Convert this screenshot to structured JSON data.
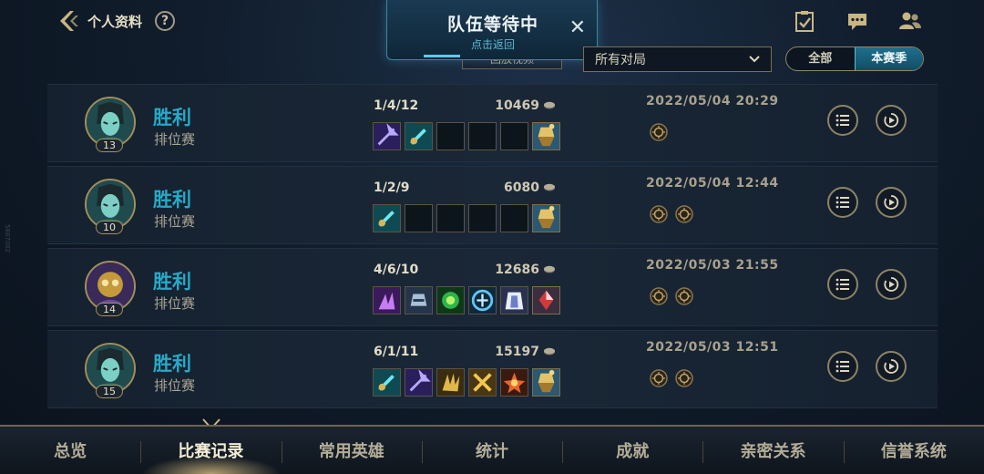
{
  "header": {
    "title": "个人资料",
    "help_label": "?",
    "icons": [
      "clipboard-check-icon",
      "chat-icon",
      "friends-icon"
    ]
  },
  "queue": {
    "title": "队伍等待中",
    "subtitle": "点击返回",
    "close_label": "✕",
    "hidden_tab_label": "回放视频"
  },
  "filter": {
    "selected": "所有对局",
    "season_options": [
      "全部",
      "本赛季"
    ],
    "season_active": "本赛季"
  },
  "matches": [
    {
      "result": "胜利",
      "mode": "排位赛",
      "level": "13",
      "kda": "1/4/12",
      "gold": "10469",
      "date": "2022/05/04 20:29",
      "champion": "teal",
      "items": [
        "purple-axe",
        "teal-blade",
        "",
        "",
        "",
        "gold-lantern"
      ],
      "badges": 1
    },
    {
      "result": "胜利",
      "mode": "排位赛",
      "level": "10",
      "kda": "1/2/9",
      "gold": "6080",
      "date": "2022/05/04 12:44",
      "champion": "teal",
      "items": [
        "teal-blade",
        "",
        "",
        "",
        "",
        "gold-lantern"
      ],
      "badges": 2
    },
    {
      "result": "胜利",
      "mode": "排位赛",
      "level": "14",
      "kda": "4/6/10",
      "gold": "12686",
      "date": "2022/05/03 21:55",
      "champion": "purple",
      "items": [
        "purple-claw",
        "steel-helm",
        "green-orb",
        "blue-rune",
        "white-cloak",
        "red-gem"
      ],
      "badges": 2
    },
    {
      "result": "胜利",
      "mode": "排位赛",
      "level": "15",
      "kda": "6/1/11",
      "gold": "15197",
      "date": "2022/05/03 12:51",
      "champion": "teal",
      "items": [
        "teal-blade",
        "purple-axe",
        "gold-claw",
        "gold-cross",
        "red-star",
        "gold-lantern"
      ],
      "badges": 2
    }
  ],
  "nav": {
    "items": [
      "总览",
      "比赛记录",
      "常用英雄",
      "统计",
      "成就",
      "亲密关系",
      "信誉系统"
    ],
    "active": "比赛记录"
  },
  "side_mark": "5887002",
  "colors": {
    "accent_teal": "#27a9c8",
    "gold_border": "#a38e5a",
    "background": "#111d2c"
  }
}
